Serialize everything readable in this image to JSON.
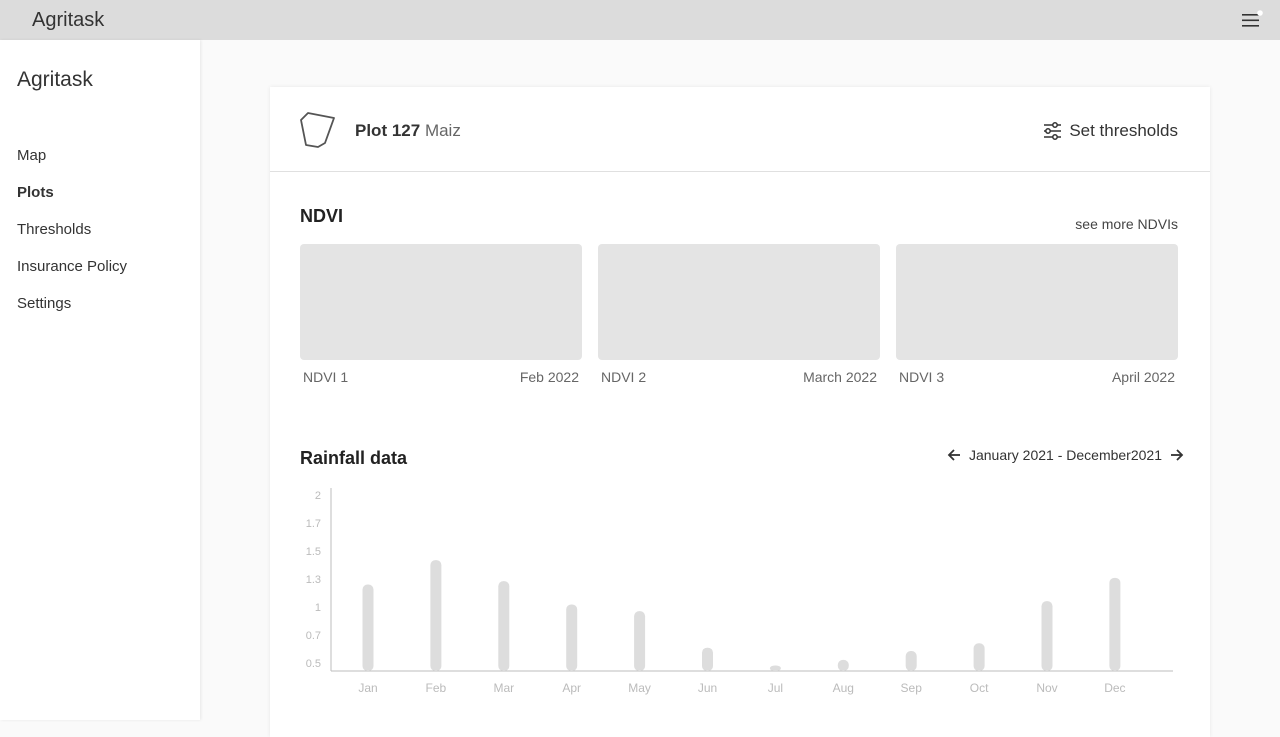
{
  "app": {
    "brand": "Agritask"
  },
  "sidebar": {
    "brand": "Agritask",
    "items": [
      {
        "label": "Map",
        "active": false
      },
      {
        "label": "Plots",
        "active": true
      },
      {
        "label": "Thresholds",
        "active": false
      },
      {
        "label": "Insurance Policy",
        "active": false
      },
      {
        "label": "Settings",
        "active": false
      }
    ]
  },
  "plot": {
    "name": "Plot 127",
    "crop": "Maiz",
    "set_thresholds_label": "Set thresholds"
  },
  "ndvi": {
    "title": "NDVI",
    "see_more": "see more NDVIs",
    "items": [
      {
        "label": "NDVI 1",
        "date": "Feb 2022"
      },
      {
        "label": "NDVI 2",
        "date": "March 2022"
      },
      {
        "label": "NDVI 3",
        "date": "April 2022"
      }
    ]
  },
  "rainfall": {
    "title": "Rainfall data",
    "range_label": "January 2021 - December2021"
  },
  "chart_data": {
    "type": "bar",
    "categories": [
      "Jan",
      "Feb",
      "Mar",
      "Apr",
      "May",
      "Jun",
      "Jul",
      "Aug",
      "Sep",
      "Oct",
      "Nov",
      "Dec"
    ],
    "values": [
      1.23,
      1.45,
      1.26,
      1.05,
      0.99,
      0.66,
      0.5,
      0.55,
      0.63,
      0.7,
      1.08,
      1.29
    ],
    "yticks": [
      "2",
      "1.7",
      "1.5",
      "1.3",
      "1",
      "0.7",
      "0.5"
    ],
    "ylim": [
      0.45,
      2.1
    ],
    "grid": false,
    "colors": {
      "bar": "#dddddd",
      "axis": "#bdbdbd",
      "tick": "#bbbbbb"
    }
  }
}
